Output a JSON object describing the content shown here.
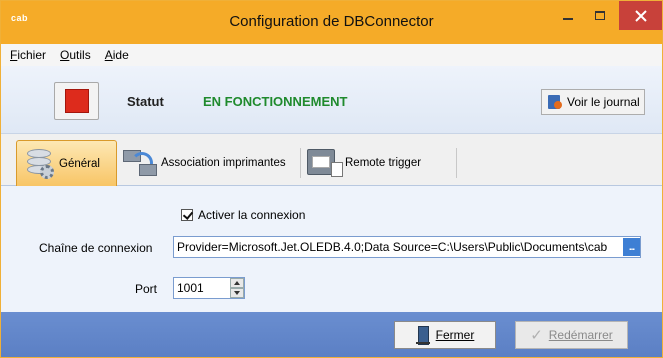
{
  "window": {
    "app_logo": "cab",
    "title": "Configuration de DBConnector"
  },
  "menu": {
    "items": [
      "Fichier",
      "Outils",
      "Aide"
    ]
  },
  "status": {
    "label": "Statut",
    "value": "EN FONCTIONNEMENT",
    "value_color": "#1f8a2d",
    "stop_button_color": "#dd2b1c",
    "journal_button": "Voir le journal"
  },
  "tabs": [
    {
      "label": "Général",
      "icon": "database-gear-icon",
      "selected": true
    },
    {
      "label": "Association imprimantes",
      "icon": "printers-sync-icon",
      "selected": false
    },
    {
      "label": "Remote trigger",
      "icon": "printer-remote-icon",
      "selected": false
    }
  ],
  "general": {
    "enable_connection_label": "Activer la connexion",
    "enable_connection_checked": true,
    "connection_string_label": "Chaîne de connexion",
    "connection_string_value": "Provider=Microsoft.Jet.OLEDB.4.0;Data Source=C:\\Users\\Public\\Documents\\cab",
    "ellipsis_label": "...",
    "port_label": "Port",
    "port_value": "1001"
  },
  "footer": {
    "close_button": "Fermer",
    "restart_button": "Redémarrer",
    "restart_enabled": false
  },
  "colors": {
    "titlebar": "#f5ab28",
    "close_button": "#c8413a",
    "footer": "#5b7fc4",
    "selected_tab": "#f8c566"
  }
}
